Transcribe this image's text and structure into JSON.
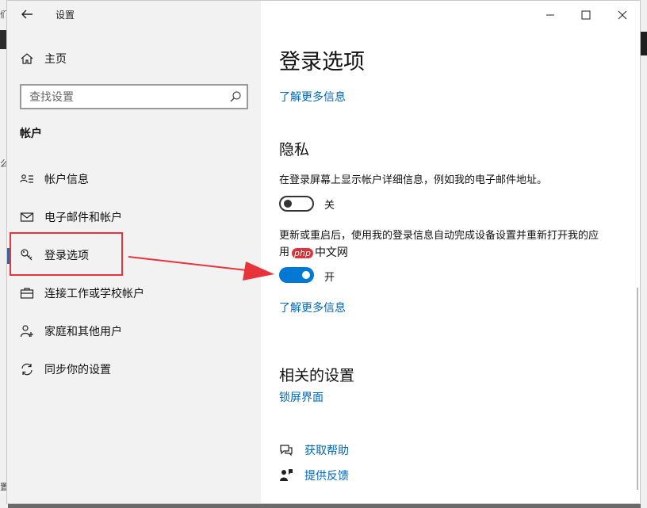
{
  "window": {
    "title": "设置"
  },
  "sidebar": {
    "home_label": "主页",
    "search_placeholder": "查找设置",
    "section_label": "帐户",
    "items": [
      {
        "label": "帐户信息",
        "icon": "account-info-icon"
      },
      {
        "label": "电子邮件和帐户",
        "icon": "mail-icon"
      },
      {
        "label": "登录选项",
        "icon": "key-icon",
        "selected": true
      },
      {
        "label": "连接工作或学校帐户",
        "icon": "briefcase-icon"
      },
      {
        "label": "家庭和其他用户",
        "icon": "add-person-icon"
      },
      {
        "label": "同步你的设置",
        "icon": "sync-icon"
      }
    ]
  },
  "content": {
    "page_title": "登录选项",
    "learn_more_top": "了解更多信息",
    "privacy": {
      "heading": "隐私",
      "setting1_desc": "在登录屏幕上显示帐户详细信息，例如我的电子邮件地址。",
      "setting1_state": "关",
      "setting2_desc": "更新或重启后，使用我的登录信息自动完成设备设置并重新打开我的应用",
      "setting2_state": "开",
      "learn_more": "了解更多信息"
    },
    "related": {
      "heading": "相关的设置",
      "lockscreen_link": "锁屏界面"
    },
    "help": {
      "get_help": "获取帮助",
      "feedback": "提供反馈"
    }
  },
  "overlay": {
    "watermark_badge": "php",
    "watermark_text": "中文网"
  },
  "colors": {
    "accent": "#0078d4",
    "link": "#0067b8",
    "annotation_red": "#e8333a"
  },
  "background_fragments": {
    "char1": "们",
    "char2": "么",
    "char3": "置"
  }
}
